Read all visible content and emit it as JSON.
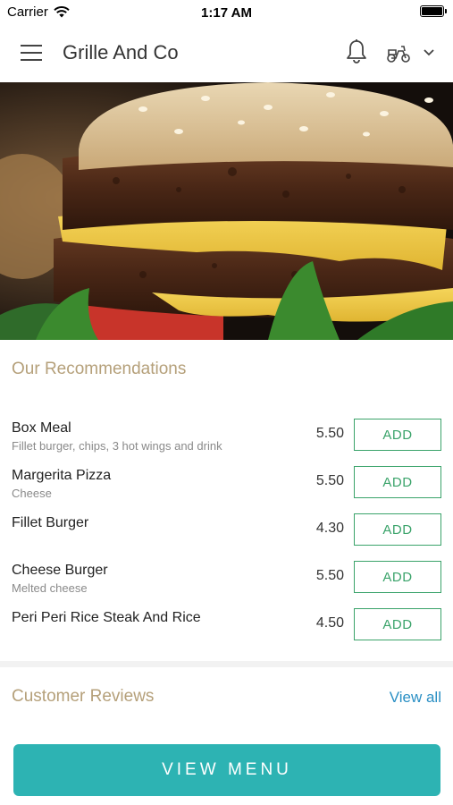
{
  "status_bar": {
    "carrier": "Carrier",
    "time": "1:17 AM"
  },
  "header": {
    "title": "Grille And Co",
    "icons": [
      "menu-icon",
      "bell-icon",
      "scooter-icon",
      "chevron-down-icon"
    ]
  },
  "recommendations": {
    "title": "Our Recommendations",
    "items": [
      {
        "name": "Box Meal",
        "description": "Fillet burger, chips, 3 hot wings and drink",
        "price": "5.50",
        "button": "ADD"
      },
      {
        "name": "Margerita Pizza",
        "description": "Cheese",
        "price": "5.50",
        "button": "ADD"
      },
      {
        "name": "Fillet Burger",
        "description": "",
        "price": "4.30",
        "button": "ADD"
      },
      {
        "name": "Cheese Burger",
        "description": "Melted cheese",
        "price": "5.50",
        "button": "ADD"
      },
      {
        "name": "Peri Peri Rice Steak And Rice",
        "description": "",
        "price": "4.50",
        "button": "ADD"
      }
    ]
  },
  "reviews": {
    "title": "Customer Reviews",
    "view_all": "View all"
  },
  "footer": {
    "view_menu": "VIEW MENU"
  },
  "colors": {
    "section_title": "#b5a07a",
    "add_green": "#3aa36a",
    "link_blue": "#2a8fc4",
    "view_menu_teal": "#2db3b3"
  }
}
